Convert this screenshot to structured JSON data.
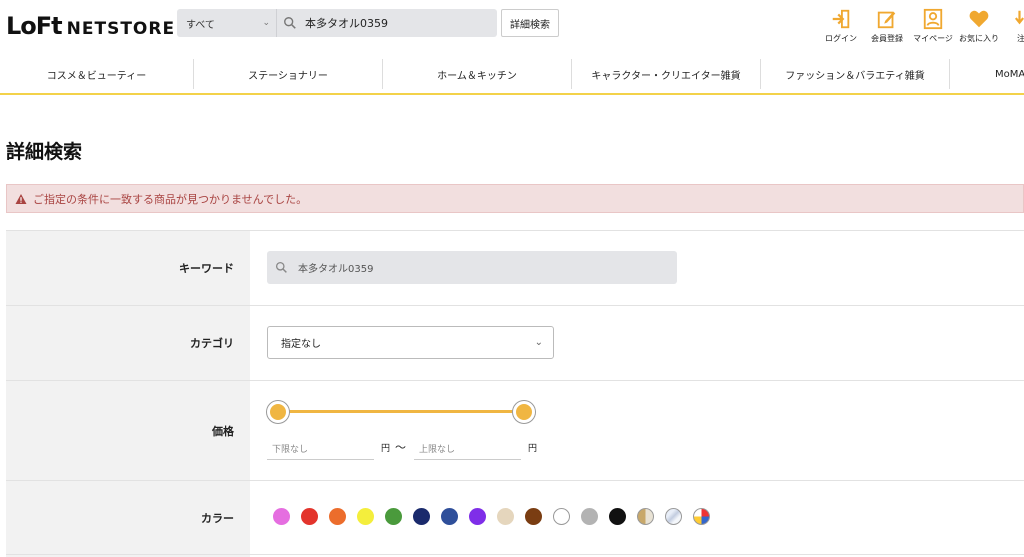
{
  "header": {
    "logo_mark": "LoFt",
    "logo_text": "NETSTORE",
    "search_scope": "すべて",
    "search_query": "本多タオル0359",
    "advanced_search_label": "詳細検索",
    "icons": [
      {
        "label": "ログイン",
        "icon": "login-icon"
      },
      {
        "label": "会員登録",
        "icon": "register-icon"
      },
      {
        "label": "マイページ",
        "icon": "mypage-icon"
      },
      {
        "label": "お気に入り",
        "icon": "heart-icon"
      },
      {
        "label": "注文",
        "icon": "order-icon"
      }
    ],
    "accent": "#f0a830"
  },
  "nav": {
    "categories": [
      "コスメ＆ビューティー",
      "ステーショナリー",
      "ホーム＆キッチン",
      "キャラクター・クリエイター雑貨",
      "ファッション＆バラエティ雑貨",
      "MoMA"
    ]
  },
  "page": {
    "title": "詳細検索",
    "alert": "ご指定の条件に一致する商品が見つかりませんでした。"
  },
  "form": {
    "keyword_label": "キーワード",
    "keyword_value": "本多タオル0359",
    "category_label": "カテゴリ",
    "category_value": "指定なし",
    "price_label": "価格",
    "price_min_placeholder": "下限なし",
    "price_max_placeholder": "上限なし",
    "yen": "円",
    "tilde": "〜",
    "color_label": "カラー",
    "colors": [
      "#e56ee0",
      "#e3342c",
      "#ec6d2c",
      "#f4ee3c",
      "#4a9a3c",
      "#1a2a6c",
      "#2f4f9a",
      "#7f2ee8",
      "#e5d6bd",
      "#7a3d12",
      "#ffffff",
      "#b3b3b3",
      "#111111",
      "gold-beige",
      "silver",
      "multi"
    ]
  }
}
